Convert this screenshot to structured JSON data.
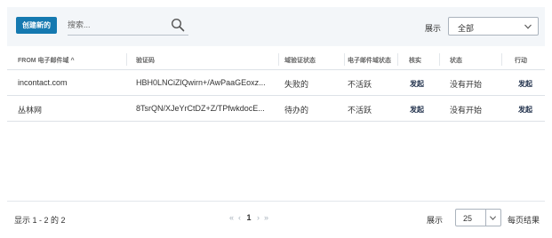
{
  "toolbar": {
    "create_label": "创建新的",
    "search_placeholder": "搜索...",
    "show_label": "展示",
    "filter_value": "全部"
  },
  "table": {
    "headers": [
      "FROM 电子邮件域 ^",
      "验证码",
      "域验证状态",
      "电子邮件域状态",
      "核实",
      "状态",
      "行动"
    ],
    "rows": [
      [
        "incontact.com",
        "HBH0LNCiZlQwirn+/AwPaaGEoxz...",
        "失败的",
        "不活跃",
        "发起",
        "没有开始",
        "发起"
      ],
      [
        "丛林网",
        "8TsrQN/XJeYrCtDZ+Z/TPfwkdocE...",
        "待办的",
        "不活跃",
        "发起",
        "没有开始",
        "发起"
      ]
    ]
  },
  "footer": {
    "showing": "显示 1 - 2 的 2",
    "pager": {
      "first": "«",
      "prev": "‹",
      "page": "1",
      "next": "›",
      "last": "»"
    },
    "show_label": "展示",
    "per_page": "25",
    "per_page_label": "每页结果"
  },
  "colors": {
    "accent": "#1579b0",
    "toolbar_bg": "#f3f6f9",
    "action_text": "#1f2f4a"
  },
  "icons": {
    "search": "search-icon",
    "dropdown": "chevron-down-icon"
  }
}
